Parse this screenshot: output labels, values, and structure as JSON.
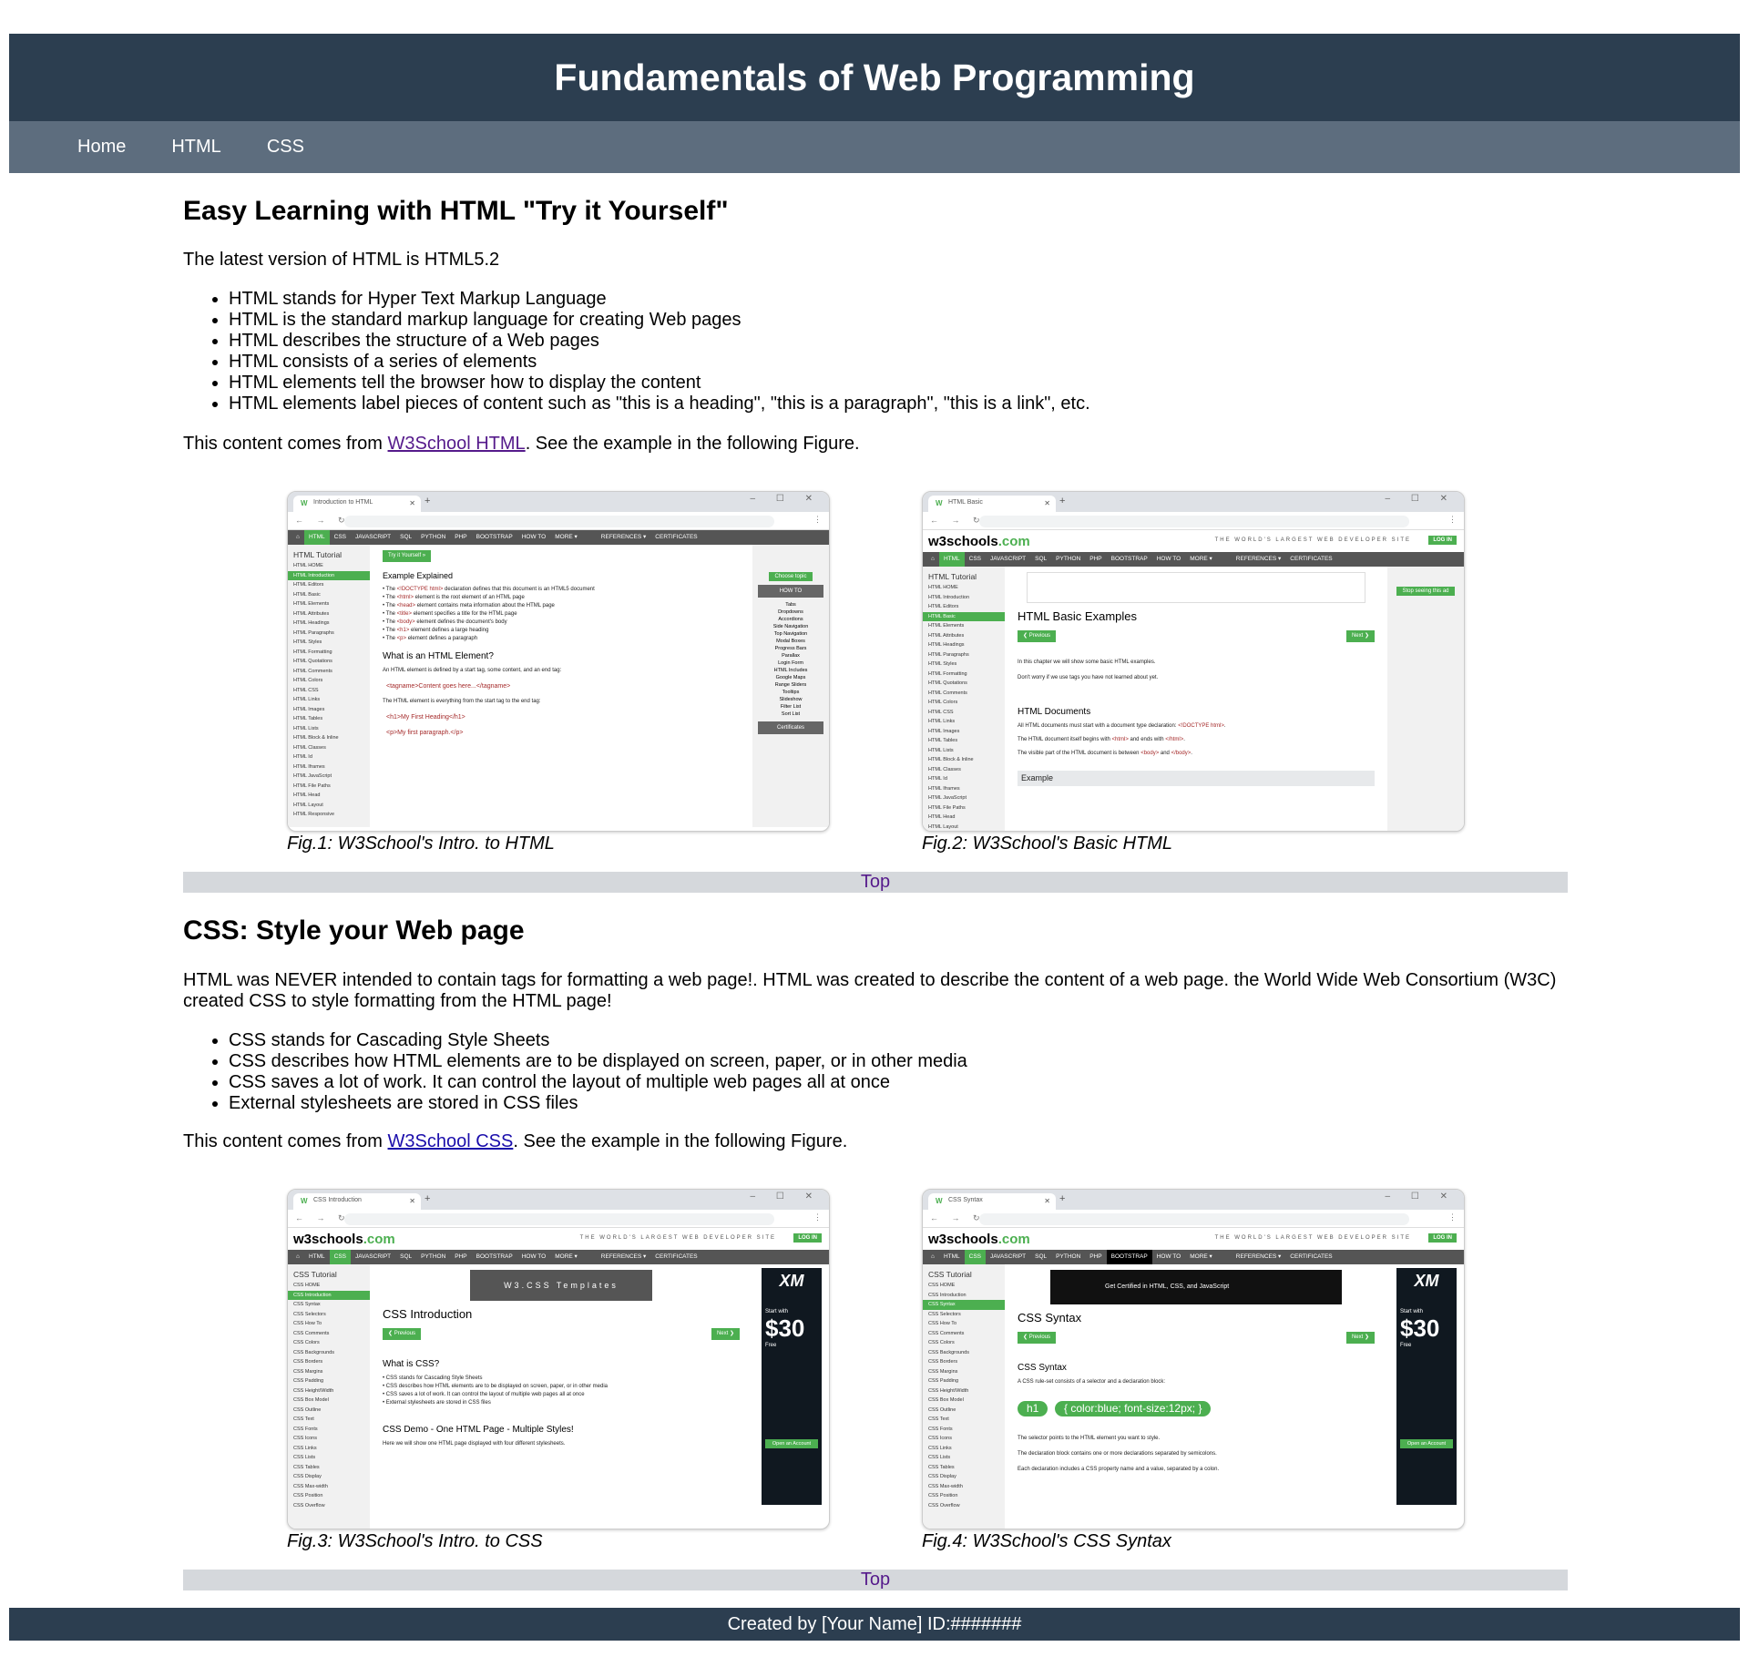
{
  "header": {
    "title": "Fundamentals of Web Programming"
  },
  "nav": {
    "items": [
      "Home",
      "HTML",
      "CSS"
    ]
  },
  "html_section": {
    "heading": "Easy Learning with HTML \"Try it Yourself\"",
    "intro": "The latest version of HTML is HTML5.2",
    "bullets": [
      "HTML stands for Hyper Text Markup Language",
      "HTML is the standard markup language for creating Web pages",
      "HTML describes the structure of a Web pages",
      "HTML consists of a series of elements",
      "HTML elements tell the browser how to display the content",
      "HTML elements label pieces of content such as \"this is a heading\", \"this is a paragraph\", \"this is a link\", etc."
    ],
    "source_prefix": "This content comes from ",
    "source_link": "W3School HTML",
    "source_suffix": ". See the example in the following Figure.",
    "fig1_caption": "Fig.1: W3School's Intro. to HTML",
    "fig2_caption": "Fig.2: W3School's Basic HTML",
    "top_link": "Top"
  },
  "css_section": {
    "heading": "CSS: Style your Web page",
    "intro": "HTML was NEVER intended to contain tags for formatting a web page!. HTML was created to describe the content of a web page. the World Wide Web Consortium (W3C) created CSS to style formatting from the HTML page!",
    "bullets": [
      "CSS stands for Cascading Style Sheets",
      "CSS describes how HTML elements are to be displayed on screen, paper, or in other media",
      "CSS saves a lot of work. It can control the layout of multiple web pages all at once",
      "External stylesheets are stored in CSS files"
    ],
    "source_prefix": "This content comes from ",
    "source_link": "W3School CSS",
    "source_suffix": ". See the example in the following Figure.",
    "fig3_caption": "Fig.3: W3School's Intro. to CSS",
    "fig4_caption": "Fig.4: W3School's CSS Syntax",
    "top_link": "Top"
  },
  "footer": {
    "text": "Created by [Your Name] ID:#######"
  },
  "screenshots": {
    "fig1": {
      "tab": "Introduction to HTML",
      "sidebar_title": "HTML Tutorial",
      "sidebar_items": [
        "HTML HOME",
        "HTML Introduction",
        "HTML Editors",
        "HTML Basic",
        "HTML Elements",
        "HTML Attributes",
        "HTML Headings",
        "HTML Paragraphs",
        "HTML Styles",
        "HTML Formatting",
        "HTML Quotations",
        "HTML Comments",
        "HTML Colors",
        "HTML CSS",
        "HTML Links",
        "HTML Images",
        "HTML Tables",
        "HTML Lists",
        "HTML Block & Inline",
        "HTML Classes",
        "HTML Id",
        "HTML Iframes",
        "HTML JavaScript",
        "HTML File Paths",
        "HTML Head",
        "HTML Layout",
        "HTML Responsive"
      ],
      "try_btn": "Try it Yourself »",
      "h_example": "Example Explained",
      "h_element": "What is an HTML Element?",
      "element_text": "An HTML element is defined by a start tag, some content, and an end tag:",
      "code1": "<tagname>Content goes here...</tagname>",
      "element_text2": "The HTML element is everything from the start tag to the end tag:",
      "code2": "<h1>My First Heading</h1>",
      "code3": "<p>My first paragraph.</p>",
      "howto": "HOW TO",
      "howto_items": [
        "Tabs",
        "Dropdowns",
        "Accordions",
        "Side Navigation",
        "Top Navigation",
        "Modal Boxes",
        "Progress Bars",
        "Parallax",
        "Login Form",
        "HTML Includes",
        "Google Maps",
        "Range Sliders",
        "Tooltips",
        "Slideshow",
        "Filter List",
        "Sort List"
      ],
      "choose_topic": "Choose topic",
      "certificates": "Certificates"
    },
    "fig2": {
      "tab": "HTML Basic",
      "sidebar_title": "HTML Tutorial",
      "h_main": "HTML Basic Examples",
      "prev": "❮ Previous",
      "next": "Next ❯",
      "line1": "In this chapter we will show some basic HTML examples.",
      "line2": "Don't worry if we use tags you have not learned about yet.",
      "h_docs": "HTML Documents",
      "example": "Example"
    },
    "fig3": {
      "tab": "CSS Introduction",
      "sidebar_title": "CSS Tutorial",
      "sidebar_items": [
        "CSS HOME",
        "CSS Introduction",
        "CSS Syntax",
        "CSS Selectors",
        "CSS How To",
        "CSS Comments",
        "CSS Colors",
        "CSS Backgrounds",
        "CSS Borders",
        "CSS Margins",
        "CSS Padding",
        "CSS Height/Width",
        "CSS Box Model",
        "CSS Outline",
        "CSS Text",
        "CSS Fonts",
        "CSS Icons",
        "CSS Links",
        "CSS Lists",
        "CSS Tables",
        "CSS Display",
        "CSS Max-width",
        "CSS Position",
        "CSS Overflow"
      ],
      "banner": "W3.CSS Templates",
      "h_main": "CSS Introduction",
      "h_what": "What is CSS?",
      "h_demo": "CSS Demo - One HTML Page - Multiple Styles!",
      "ad_price": "$30"
    },
    "fig4": {
      "tab": "CSS Syntax",
      "sidebar_title": "CSS Tutorial",
      "banner": "Get Certified in HTML, CSS, and JavaScript",
      "h_main": "CSS Syntax",
      "h_sub": "CSS Syntax",
      "selector": "h1",
      "declaration": "{ color:blue; font-size:12px; }",
      "ad_price": "$30"
    }
  }
}
